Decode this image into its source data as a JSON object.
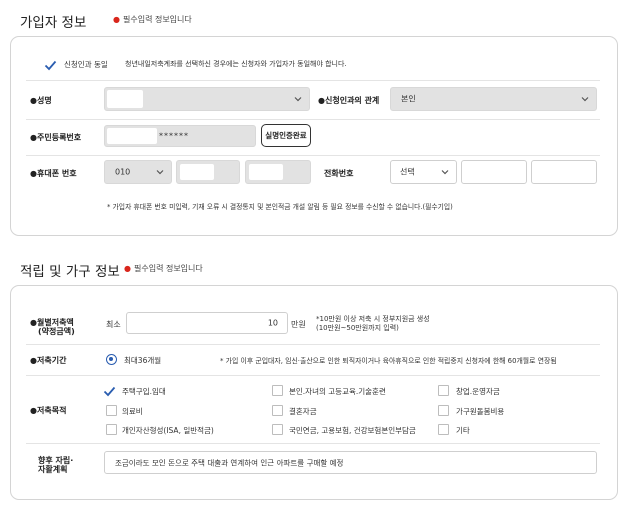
{
  "section1": {
    "title": "가입자 정보",
    "required_note": "필수입력 정보입니다",
    "consent": {
      "label": "신청인과 동일",
      "description": "청년내일저축계좌를 선택하신 경우에는 신청자와 가입자가 동일해야 합니다."
    },
    "name": {
      "label": "성명",
      "value": ""
    },
    "relation": {
      "label": "신청인과의 관계",
      "value": "본인"
    },
    "rrn": {
      "label": "주민등록번호",
      "masked": "******",
      "button": "실명인증완료"
    },
    "mobile": {
      "label": "휴대폰 번호",
      "prefix": "010",
      "middle": "",
      "last": ""
    },
    "phone": {
      "label": "전화번호",
      "prefix": "선택",
      "middle": "",
      "last": ""
    },
    "footnote": "* 가입자 휴대폰 번호 미입력, 기재 오류 시 결정통지 및 본인적금 개설 알림 등 필요 정보를 수신할 수 없습니다.(필수기입)"
  },
  "section2": {
    "title": "적립 및 가구 정보",
    "required_note": "필수입력 정보입니다",
    "monthly": {
      "label_line1": "월별저축액",
      "label_line2": "(약정금액)",
      "prefix": "최소",
      "value": "10",
      "unit": "만원",
      "hint_line1": "*10만원 이상 저축 시 정부지원금 생성",
      "hint_line2": "(10만원~50만원까지 입력)"
    },
    "period": {
      "label": "저축기간",
      "option": "최대36개월",
      "note": "* 가입 이후 군입대자, 임신·출산으로 인한 퇴직자이거나 육아휴직으로 인한 적립중지 신청자에 한해 60개월로 연장됨"
    },
    "purpose": {
      "label": "저축목적",
      "options": [
        {
          "text": "주택구입.임대",
          "checked": true
        },
        {
          "text": "본인.자녀의 고등교육.기술훈련",
          "checked": false
        },
        {
          "text": "창업.운영자금",
          "checked": false
        },
        {
          "text": "의료비",
          "checked": false
        },
        {
          "text": "결혼자금",
          "checked": false
        },
        {
          "text": "가구원돌봄비용",
          "checked": false
        },
        {
          "text": "개인자산형성(ISA, 일반적금)",
          "checked": false
        },
        {
          "text": "국민연금, 고용보험, 건강보험본인부담금",
          "checked": false
        },
        {
          "text": "기타",
          "checked": false
        }
      ]
    },
    "plan": {
      "label_line1": "향후 자립·",
      "label_line2": "자활계획",
      "value": "조금이라도 모인 돈으로 주택 대출과 연계하여 인근 아파트를 구매할 예정"
    }
  },
  "colors": {
    "required_dot": "#d9261c",
    "accent": "#2a5db0"
  }
}
